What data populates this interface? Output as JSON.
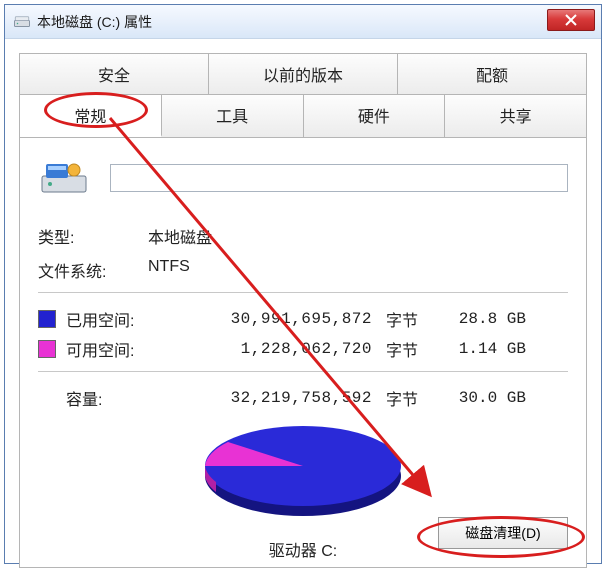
{
  "window": {
    "title": "本地磁盘 (C:) 属性"
  },
  "tabs_top": [
    {
      "label": "安全"
    },
    {
      "label": "以前的版本"
    },
    {
      "label": "配额"
    }
  ],
  "tabs_bottom": [
    {
      "label": "常规",
      "active": true
    },
    {
      "label": "工具"
    },
    {
      "label": "硬件"
    },
    {
      "label": "共享"
    }
  ],
  "general": {
    "name_value": "",
    "type_label": "类型:",
    "type_value": "本地磁盘",
    "fs_label": "文件系统:",
    "fs_value": "NTFS",
    "used_label": "已用空间:",
    "used_bytes": "30,991,695,872",
    "used_unit": "字节",
    "used_gb": "28.8 GB",
    "free_label": "可用空间:",
    "free_bytes": "1,228,062,720",
    "free_unit": "字节",
    "free_gb": "1.14 GB",
    "cap_label": "容量:",
    "cap_bytes": "32,219,758,592",
    "cap_unit": "字节",
    "cap_gb": "30.0 GB",
    "drive_label": "驱动器 C:",
    "cleanup_label": "磁盘清理(D)"
  },
  "chart_data": {
    "type": "pie",
    "title": "",
    "series": [
      {
        "name": "已用空间",
        "value": 28.8,
        "color": "#2222d0"
      },
      {
        "name": "可用空间",
        "value": 1.14,
        "color": "#e832d4"
      }
    ],
    "unit": "GB"
  },
  "colors": {
    "used": "#2222d0",
    "free": "#e832d4",
    "annotation": "#d81e1e"
  }
}
